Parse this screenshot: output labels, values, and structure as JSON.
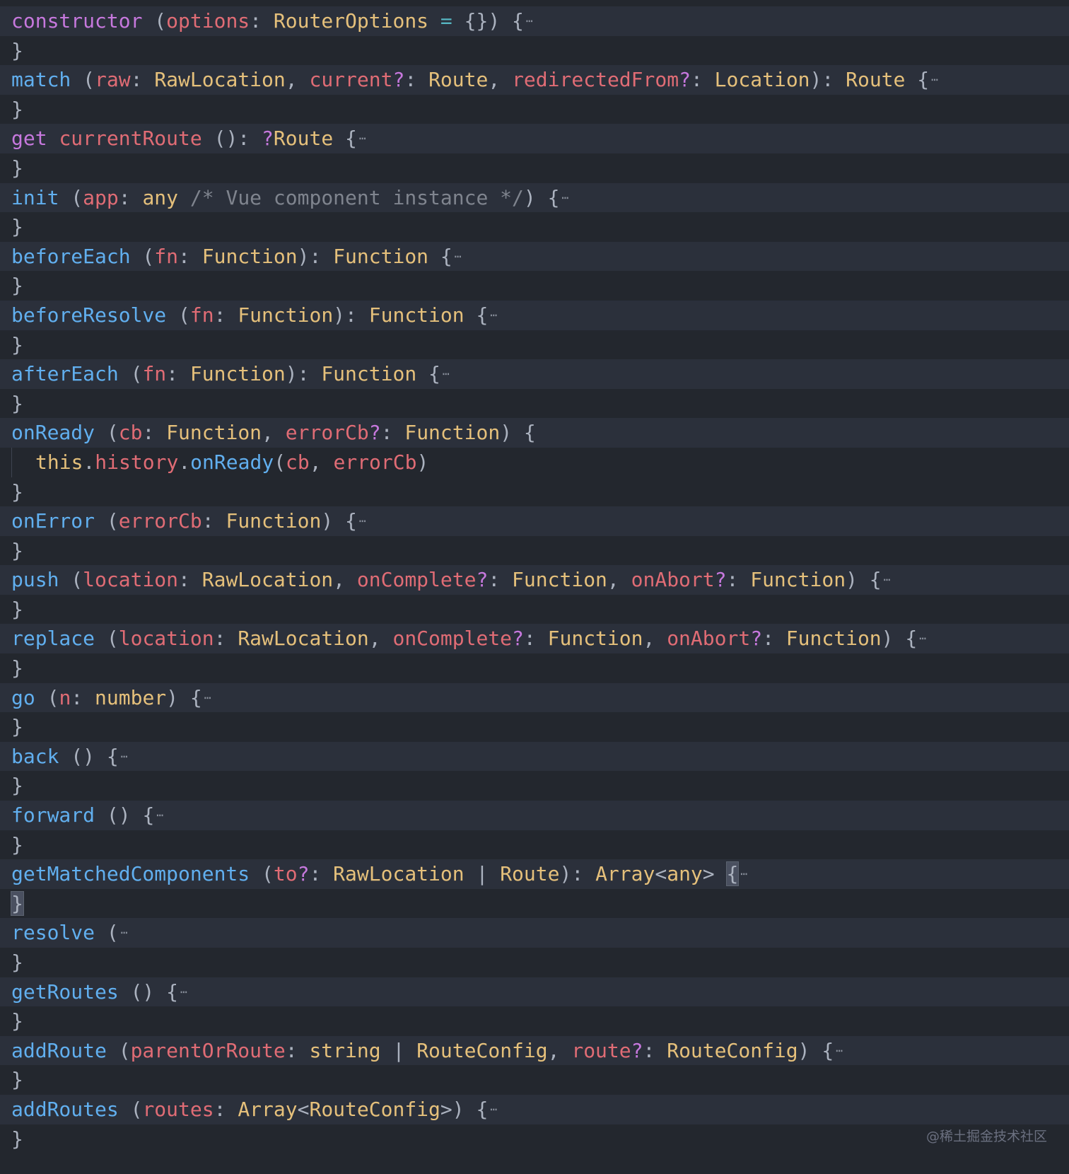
{
  "colors": {
    "keyword": "#c678dd",
    "function": "#61afef",
    "param": "#e06c75",
    "type": "#e5c07b",
    "punct": "#abb2bf",
    "comment": "#7f848e",
    "operator": "#56b6c2",
    "background": "#23272e",
    "highlight_row": "#2b303b"
  },
  "lines": [
    {
      "bg": "sig",
      "tokens": [
        [
          "k",
          "constructor"
        ],
        [
          "o",
          " ("
        ],
        [
          "p",
          "options"
        ],
        [
          "o",
          ": "
        ],
        [
          "t",
          "RouterOptions"
        ],
        [
          "o",
          " "
        ],
        [
          "e",
          "="
        ],
        [
          "o",
          " {}) {"
        ],
        [
          "x",
          "⋯"
        ]
      ]
    },
    {
      "bg": "dark",
      "tokens": [
        [
          "o",
          "}"
        ]
      ]
    },
    {
      "bg": "sig",
      "tokens": [
        [
          "f",
          "match"
        ],
        [
          "o",
          " ("
        ],
        [
          "p",
          "raw"
        ],
        [
          "o",
          ": "
        ],
        [
          "t",
          "RawLocation"
        ],
        [
          "o",
          ", "
        ],
        [
          "p",
          "current"
        ],
        [
          "q",
          "?"
        ],
        [
          "o",
          ": "
        ],
        [
          "t",
          "Route"
        ],
        [
          "o",
          ", "
        ],
        [
          "p",
          "redirectedFrom"
        ],
        [
          "q",
          "?"
        ],
        [
          "o",
          ": "
        ],
        [
          "t",
          "Location"
        ],
        [
          "o",
          "): "
        ],
        [
          "t",
          "Route"
        ],
        [
          "o",
          " {"
        ],
        [
          "x",
          "⋯"
        ]
      ]
    },
    {
      "bg": "dark",
      "tokens": [
        [
          "o",
          "}"
        ]
      ]
    },
    {
      "bg": "sig",
      "tokens": [
        [
          "k",
          "get"
        ],
        [
          "o",
          " "
        ],
        [
          "p",
          "currentRoute"
        ],
        [
          "o",
          " (): "
        ],
        [
          "q",
          "?"
        ],
        [
          "t",
          "Route"
        ],
        [
          "o",
          " {"
        ],
        [
          "x",
          "⋯"
        ]
      ]
    },
    {
      "bg": "dark",
      "tokens": [
        [
          "o",
          "}"
        ]
      ]
    },
    {
      "bg": "sig",
      "tokens": [
        [
          "f",
          "init"
        ],
        [
          "o",
          " ("
        ],
        [
          "p",
          "app"
        ],
        [
          "o",
          ": "
        ],
        [
          "t",
          "any"
        ],
        [
          "o",
          " "
        ],
        [
          "c",
          "/* Vue component instance */"
        ],
        [
          "o",
          ") {"
        ],
        [
          "x",
          "⋯"
        ]
      ]
    },
    {
      "bg": "dark",
      "tokens": [
        [
          "o",
          "}"
        ]
      ]
    },
    {
      "bg": "sig",
      "tokens": [
        [
          "f",
          "beforeEach"
        ],
        [
          "o",
          " ("
        ],
        [
          "p",
          "fn"
        ],
        [
          "o",
          ": "
        ],
        [
          "t",
          "Function"
        ],
        [
          "o",
          "): "
        ],
        [
          "t",
          "Function"
        ],
        [
          "o",
          " {"
        ],
        [
          "x",
          "⋯"
        ]
      ]
    },
    {
      "bg": "dark",
      "tokens": [
        [
          "o",
          "}"
        ]
      ]
    },
    {
      "bg": "sig",
      "tokens": [
        [
          "f",
          "beforeResolve"
        ],
        [
          "o",
          " ("
        ],
        [
          "p",
          "fn"
        ],
        [
          "o",
          ": "
        ],
        [
          "t",
          "Function"
        ],
        [
          "o",
          "): "
        ],
        [
          "t",
          "Function"
        ],
        [
          "o",
          " {"
        ],
        [
          "x",
          "⋯"
        ]
      ]
    },
    {
      "bg": "dark",
      "tokens": [
        [
          "o",
          "}"
        ]
      ]
    },
    {
      "bg": "sig",
      "tokens": [
        [
          "f",
          "afterEach"
        ],
        [
          "o",
          " ("
        ],
        [
          "p",
          "fn"
        ],
        [
          "o",
          ": "
        ],
        [
          "t",
          "Function"
        ],
        [
          "o",
          "): "
        ],
        [
          "t",
          "Function"
        ],
        [
          "o",
          " {"
        ],
        [
          "x",
          "⋯"
        ]
      ]
    },
    {
      "bg": "dark",
      "tokens": [
        [
          "o",
          "}"
        ]
      ]
    },
    {
      "bg": "sig",
      "tokens": [
        [
          "f",
          "onReady"
        ],
        [
          "o",
          " ("
        ],
        [
          "p",
          "cb"
        ],
        [
          "o",
          ": "
        ],
        [
          "t",
          "Function"
        ],
        [
          "o",
          ", "
        ],
        [
          "p",
          "errorCb"
        ],
        [
          "q",
          "?"
        ],
        [
          "o",
          ": "
        ],
        [
          "t",
          "Function"
        ],
        [
          "o",
          ") {"
        ]
      ]
    },
    {
      "bg": "dark",
      "guide": true,
      "tokens": [
        [
          "t",
          "this"
        ],
        [
          "o",
          "."
        ],
        [
          "p",
          "history"
        ],
        [
          "o",
          "."
        ],
        [
          "f",
          "onReady"
        ],
        [
          "o",
          "("
        ],
        [
          "p",
          "cb"
        ],
        [
          "o",
          ", "
        ],
        [
          "p",
          "errorCb"
        ],
        [
          "o",
          ")"
        ]
      ]
    },
    {
      "bg": "dark",
      "tokens": [
        [
          "o",
          "}"
        ]
      ]
    },
    {
      "bg": "sig",
      "tokens": [
        [
          "f",
          "onError"
        ],
        [
          "o",
          " ("
        ],
        [
          "p",
          "errorCb"
        ],
        [
          "o",
          ": "
        ],
        [
          "t",
          "Function"
        ],
        [
          "o",
          ") {"
        ],
        [
          "x",
          "⋯"
        ]
      ]
    },
    {
      "bg": "dark",
      "tokens": [
        [
          "o",
          "}"
        ]
      ]
    },
    {
      "bg": "sig",
      "tokens": [
        [
          "f",
          "push"
        ],
        [
          "o",
          " ("
        ],
        [
          "p",
          "location"
        ],
        [
          "o",
          ": "
        ],
        [
          "t",
          "RawLocation"
        ],
        [
          "o",
          ", "
        ],
        [
          "p",
          "onComplete"
        ],
        [
          "q",
          "?"
        ],
        [
          "o",
          ": "
        ],
        [
          "t",
          "Function"
        ],
        [
          "o",
          ", "
        ],
        [
          "p",
          "onAbort"
        ],
        [
          "q",
          "?"
        ],
        [
          "o",
          ": "
        ],
        [
          "t",
          "Function"
        ],
        [
          "o",
          ") {"
        ],
        [
          "x",
          "⋯"
        ]
      ]
    },
    {
      "bg": "dark",
      "tokens": [
        [
          "o",
          "}"
        ]
      ]
    },
    {
      "bg": "sig",
      "tokens": [
        [
          "f",
          "replace"
        ],
        [
          "o",
          " ("
        ],
        [
          "p",
          "location"
        ],
        [
          "o",
          ": "
        ],
        [
          "t",
          "RawLocation"
        ],
        [
          "o",
          ", "
        ],
        [
          "p",
          "onComplete"
        ],
        [
          "q",
          "?"
        ],
        [
          "o",
          ": "
        ],
        [
          "t",
          "Function"
        ],
        [
          "o",
          ", "
        ],
        [
          "p",
          "onAbort"
        ],
        [
          "q",
          "?"
        ],
        [
          "o",
          ": "
        ],
        [
          "t",
          "Function"
        ],
        [
          "o",
          ") {"
        ],
        [
          "x",
          "⋯"
        ]
      ]
    },
    {
      "bg": "dark",
      "tokens": [
        [
          "o",
          "}"
        ]
      ]
    },
    {
      "bg": "sig",
      "tokens": [
        [
          "f",
          "go"
        ],
        [
          "o",
          " ("
        ],
        [
          "p",
          "n"
        ],
        [
          "o",
          ": "
        ],
        [
          "t",
          "number"
        ],
        [
          "o",
          ") {"
        ],
        [
          "x",
          "⋯"
        ]
      ]
    },
    {
      "bg": "dark",
      "tokens": [
        [
          "o",
          "}"
        ]
      ]
    },
    {
      "bg": "sig",
      "tokens": [
        [
          "f",
          "back"
        ],
        [
          "o",
          " () {"
        ],
        [
          "x",
          "⋯"
        ]
      ]
    },
    {
      "bg": "dark",
      "tokens": [
        [
          "o",
          "}"
        ]
      ]
    },
    {
      "bg": "sig",
      "tokens": [
        [
          "f",
          "forward"
        ],
        [
          "o",
          " () {"
        ],
        [
          "x",
          "⋯"
        ]
      ]
    },
    {
      "bg": "dark",
      "tokens": [
        [
          "o",
          "}"
        ]
      ]
    },
    {
      "bg": "sig",
      "tokens": [
        [
          "f",
          "getMatchedComponents"
        ],
        [
          "o",
          " ("
        ],
        [
          "p",
          "to"
        ],
        [
          "q",
          "?"
        ],
        [
          "o",
          ": "
        ],
        [
          "t",
          "RawLocation"
        ],
        [
          "o",
          " | "
        ],
        [
          "t",
          "Route"
        ],
        [
          "o",
          "): "
        ],
        [
          "t",
          "Array"
        ],
        [
          "o",
          "<"
        ],
        [
          "t",
          "any"
        ],
        [
          "o",
          "> "
        ],
        [
          "h",
          "{"
        ],
        [
          "x",
          "⋯"
        ]
      ]
    },
    {
      "bg": "dark",
      "tokens": [
        [
          "h",
          "}"
        ]
      ]
    },
    {
      "bg": "sig",
      "tokens": [
        [
          "f",
          "resolve"
        ],
        [
          "o",
          " ("
        ],
        [
          "x",
          "⋯"
        ]
      ]
    },
    {
      "bg": "dark",
      "tokens": [
        [
          "o",
          "}"
        ]
      ]
    },
    {
      "bg": "sig",
      "tokens": [
        [
          "f",
          "getRoutes"
        ],
        [
          "o",
          " () {"
        ],
        [
          "x",
          "⋯"
        ]
      ]
    },
    {
      "bg": "dark",
      "tokens": [
        [
          "o",
          "}"
        ]
      ]
    },
    {
      "bg": "sig",
      "tokens": [
        [
          "f",
          "addRoute"
        ],
        [
          "o",
          " ("
        ],
        [
          "p",
          "parentOrRoute"
        ],
        [
          "o",
          ": "
        ],
        [
          "t",
          "string"
        ],
        [
          "o",
          " | "
        ],
        [
          "t",
          "RouteConfig"
        ],
        [
          "o",
          ", "
        ],
        [
          "p",
          "route"
        ],
        [
          "q",
          "?"
        ],
        [
          "o",
          ": "
        ],
        [
          "t",
          "RouteConfig"
        ],
        [
          "o",
          ") {"
        ],
        [
          "x",
          "⋯"
        ]
      ]
    },
    {
      "bg": "dark",
      "tokens": [
        [
          "o",
          "}"
        ]
      ]
    },
    {
      "bg": "sig",
      "tokens": [
        [
          "f",
          "addRoutes"
        ],
        [
          "o",
          " ("
        ],
        [
          "p",
          "routes"
        ],
        [
          "o",
          ": "
        ],
        [
          "t",
          "Array"
        ],
        [
          "o",
          "<"
        ],
        [
          "t",
          "RouteConfig"
        ],
        [
          "o",
          ">) {"
        ],
        [
          "x",
          "⋯"
        ]
      ]
    },
    {
      "bg": "dark",
      "tokens": [
        [
          "o",
          "}"
        ]
      ]
    }
  ],
  "watermark": "@稀土掘金技术社区"
}
